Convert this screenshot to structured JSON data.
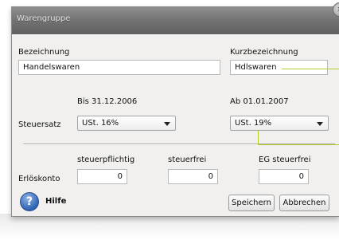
{
  "dialog": {
    "title": "Warengruppe",
    "close_icon": "×"
  },
  "fields": {
    "bezeichnung_label": "Bezeichnung",
    "bezeichnung_value": "Handelswaren",
    "kurzbezeichnung_label": "Kurzbezeichnung",
    "kurzbezeichnung_value": "Hdlswaren"
  },
  "tax": {
    "label": "Steuersatz",
    "before_header": "Bis 31.12.2006",
    "before_value": "USt. 16%",
    "after_header": "Ab 01.01.2007",
    "after_value": "USt. 19%"
  },
  "revenue": {
    "label": "Erlöskonto",
    "taxable_label": "steuerpflichtig",
    "taxable_value": "0",
    "taxfree_label": "steuerfrei",
    "taxfree_value": "0",
    "eu_taxfree_label": "EG steuerfrei",
    "eu_taxfree_value": "0"
  },
  "footer": {
    "help_label": "Hilfe",
    "help_icon": "?",
    "save_label": "Speichern",
    "cancel_label": "Abbrechen"
  },
  "colors": {
    "callout": "#b5cc2a",
    "titlebar": "#707070",
    "help_icon": "#2f63b3"
  }
}
